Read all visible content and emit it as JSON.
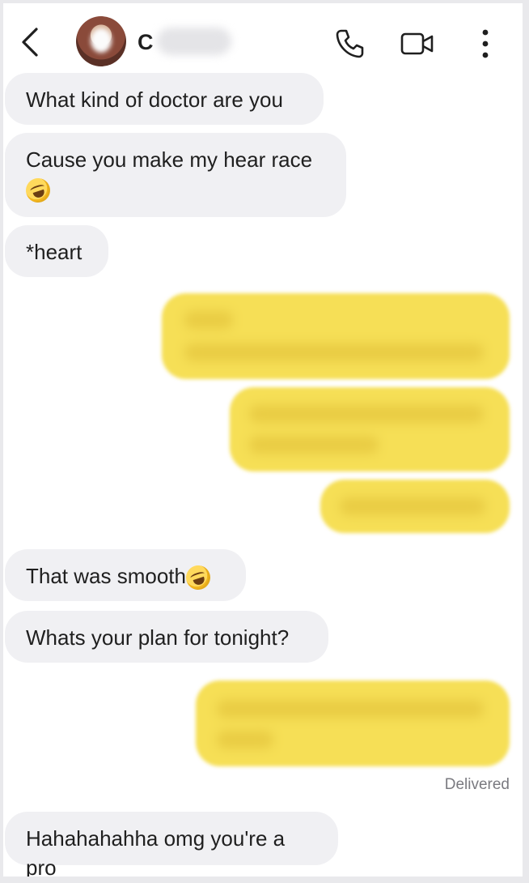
{
  "header": {
    "back_icon": "chevron-left-icon",
    "contact_initial": "C",
    "phone_icon": "phone-icon",
    "video_icon": "video-camera-icon",
    "more_icon": "more-vertical-icon"
  },
  "messages": {
    "m1": "What kind of doctor are you",
    "m2_line1": "Cause you make my hear race",
    "m2_emoji": "rolling-on-floor-laughing-emoji",
    "m3": "*heart",
    "m4": "That was smooth",
    "m4_emoji": "rolling-on-floor-laughing-emoji",
    "m5": "Whats your plan for tonight?",
    "m6": "Hahahahahha omg you're a pro"
  },
  "status": {
    "delivered": "Delivered"
  },
  "colors": {
    "incoming_bubble": "#f0f0f3",
    "outgoing_bubble": "#f6df56",
    "background": "#ffffff"
  }
}
